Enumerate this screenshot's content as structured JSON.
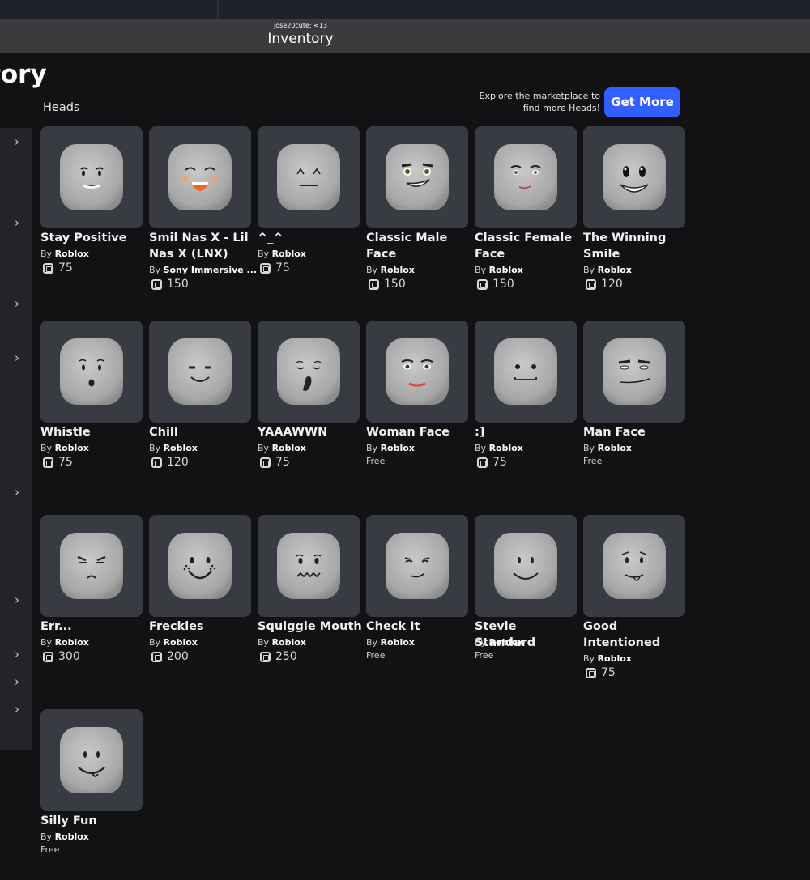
{
  "window": {
    "username": "jose20cute: <13",
    "title": "Inventory"
  },
  "page_title": "ntory",
  "section_label": "Heads",
  "explore_text": "Explore the marketplace to find more Heads!",
  "get_more_label": "Get More",
  "by_prefix": "By",
  "items": [
    {
      "name": "Stay Positive",
      "creator": "Roblox",
      "price": "75",
      "face": "stay-positive"
    },
    {
      "name": "Smil Nas X - Lil Nas X (LNX)",
      "creator": "Sony Immersive ...",
      "price": "150",
      "face": "smil-nas-x"
    },
    {
      "name": "^_^",
      "creator": "Roblox",
      "price": "75",
      "face": "caret"
    },
    {
      "name": "Classic Male Face",
      "creator": "Roblox",
      "price": "150",
      "face": "classic-male"
    },
    {
      "name": "Classic Female Face",
      "creator": "Roblox",
      "price": "150",
      "face": "classic-female"
    },
    {
      "name": "The Winning Smile",
      "creator": "Roblox",
      "price": "120",
      "face": "winning-smile"
    },
    {
      "name": "Whistle",
      "creator": "Roblox",
      "price": "75",
      "face": "whistle"
    },
    {
      "name": "Chill",
      "creator": "Roblox",
      "price": "120",
      "face": "chill"
    },
    {
      "name": "YAAAWWN",
      "creator": "Roblox",
      "price": "75",
      "face": "yawn"
    },
    {
      "name": "Woman Face",
      "creator": "Roblox",
      "price": "Free",
      "face": "woman"
    },
    {
      "name": ":]",
      "creator": "Roblox",
      "price": "75",
      "face": "bracket"
    },
    {
      "name": "Man Face",
      "creator": "Roblox",
      "price": "Free",
      "face": "man"
    },
    {
      "name": "Err...",
      "creator": "Roblox",
      "price": "300",
      "face": "err"
    },
    {
      "name": "Freckles",
      "creator": "Roblox",
      "price": "200",
      "face": "freckles"
    },
    {
      "name": "Squiggle Mouth",
      "creator": "Roblox",
      "price": "250",
      "face": "squiggle"
    },
    {
      "name": "Check It",
      "creator": "Roblox",
      "price": "Free",
      "face": "check-it"
    },
    {
      "name": "Stevie Standard",
      "creator": "Roblox",
      "price": "Free",
      "face": "stevie"
    },
    {
      "name": "Good Intentioned",
      "creator": "Roblox",
      "price": "75",
      "face": "good-intentioned"
    },
    {
      "name": "Silly Fun",
      "creator": "Roblox",
      "price": "Free",
      "face": "silly-fun"
    }
  ],
  "colors": {
    "accent": "#335fff",
    "background": "#121215",
    "card": "#393b43"
  }
}
